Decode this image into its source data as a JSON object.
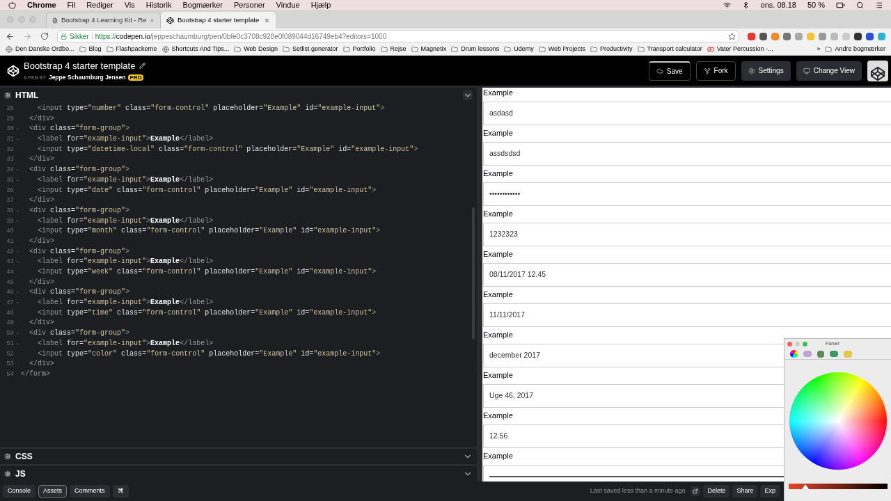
{
  "menu_bar": {
    "app": "Chrome",
    "items": [
      "Fil",
      "Rediger",
      "Vis",
      "Historik",
      "Bogmærker",
      "Personer",
      "Vindue",
      "Hjælp"
    ],
    "clock": "ons. 08.18",
    "battery": "50 %"
  },
  "tabs": [
    {
      "title": "Bootstrap 4 Learning Kit - Re",
      "selected": false,
      "kind": "document"
    },
    {
      "title": "Bootstrap 4 starter template",
      "selected": true,
      "kind": "codepen"
    }
  ],
  "address_bar": {
    "security": "Sikker",
    "scheme": "https://",
    "host": "codepen.io",
    "path": "/jeppeschaumburg/pen/0bfe0c3708c928e0f089044d16749eb4?editors=1000"
  },
  "bookmarks": [
    {
      "label": "Den Danske Ordbo...",
      "kind": "site"
    },
    {
      "label": "Blog",
      "kind": "folder"
    },
    {
      "label": "Flashpackerne",
      "kind": "folder"
    },
    {
      "label": "Shortcuts And Tips...",
      "kind": "site"
    },
    {
      "label": "Web Design",
      "kind": "folder"
    },
    {
      "label": "Setlist generator",
      "kind": "folder"
    },
    {
      "label": "Portfolio",
      "kind": "folder"
    },
    {
      "label": "Rejse",
      "kind": "folder"
    },
    {
      "label": "Magnetix",
      "kind": "folder"
    },
    {
      "label": "Drum lessons",
      "kind": "folder"
    },
    {
      "label": "Udemy",
      "kind": "folder"
    },
    {
      "label": "Web Projects",
      "kind": "folder"
    },
    {
      "label": "Productivity",
      "kind": "folder"
    },
    {
      "label": "Transport calculator",
      "kind": "folder"
    },
    {
      "label": "Vater Percussion -...",
      "kind": "video"
    }
  ],
  "bookmarks_more": "»",
  "other_bookmarks": "Andre bogmærker",
  "pen": {
    "title": "Bootstrap 4 starter template",
    "by": "A PEN BY",
    "author": "Jeppe Schaumburg Jensen",
    "badge": "PRO"
  },
  "header_buttons": [
    {
      "label": "Save",
      "kind": "save"
    },
    {
      "label": "Fork",
      "kind": "fork"
    },
    {
      "label": "Settings",
      "kind": "settings"
    },
    {
      "label": "Change View",
      "kind": "view"
    }
  ],
  "panels": [
    {
      "title": "HTML",
      "expanded": true
    },
    {
      "title": "CSS",
      "expanded": false
    },
    {
      "title": "JS",
      "expanded": false
    }
  ],
  "code_lines": [
    {
      "number": "28",
      "fold": false,
      "text": "    <input type=\"number\" class=\"form-control\" placeholder=\"Example\" id=\"example-input\">"
    },
    {
      "number": "29",
      "fold": false,
      "text": "  </div>"
    },
    {
      "number": "30",
      "fold": true,
      "text": "  <div class=\"form-group\">"
    },
    {
      "number": "31",
      "fold": true,
      "text": "    <label for=\"example-input\">Example</label>"
    },
    {
      "number": "32",
      "fold": false,
      "text": "    <input type=\"datetime-local\" class=\"form-control\" placeholder=\"Example\" id=\"example-input\">"
    },
    {
      "number": "33",
      "fold": false,
      "text": "  </div>"
    },
    {
      "number": "34",
      "fold": true,
      "text": "  <div class=\"form-group\">"
    },
    {
      "number": "35",
      "fold": true,
      "text": "    <label for=\"example-input\">Example</label>"
    },
    {
      "number": "36",
      "fold": false,
      "text": "    <input type=\"date\" class=\"form-control\" placeholder=\"Example\" id=\"example-input\">"
    },
    {
      "number": "37",
      "fold": false,
      "text": "  </div>"
    },
    {
      "number": "38",
      "fold": true,
      "text": "  <div class=\"form-group\">"
    },
    {
      "number": "39",
      "fold": true,
      "text": "    <label for=\"example-input\">Example</label>"
    },
    {
      "number": "40",
      "fold": false,
      "text": "    <input type=\"month\" class=\"form-control\" placeholder=\"Example\" id=\"example-input\">"
    },
    {
      "number": "41",
      "fold": false,
      "text": "  </div>"
    },
    {
      "number": "42",
      "fold": true,
      "text": "  <div class=\"form-group\">"
    },
    {
      "number": "43",
      "fold": true,
      "text": "    <label for=\"example-input\">Example</label>"
    },
    {
      "number": "44",
      "fold": false,
      "text": "    <input type=\"week\" class=\"form-control\" placeholder=\"Example\" id=\"example-input\">"
    },
    {
      "number": "45",
      "fold": false,
      "text": "  </div>"
    },
    {
      "number": "46",
      "fold": true,
      "text": "  <div class=\"form-group\">"
    },
    {
      "number": "47",
      "fold": true,
      "text": "    <label for=\"example-input\">Example</label>"
    },
    {
      "number": "48",
      "fold": false,
      "text": "    <input type=\"time\" class=\"form-control\" placeholder=\"Example\" id=\"example-input\">"
    },
    {
      "number": "49",
      "fold": false,
      "text": "  </div>"
    },
    {
      "number": "50",
      "fold": true,
      "text": "  <div class=\"form-group\">"
    },
    {
      "number": "51",
      "fold": true,
      "text": "    <label for=\"example-input\">Example</label>"
    },
    {
      "number": "52",
      "fold": false,
      "text": "    <input type=\"color\" class=\"form-control\" placeholder=\"Example\" id=\"example-input\">"
    },
    {
      "number": "53",
      "fold": false,
      "text": "  </div>"
    },
    {
      "number": "54",
      "fold": false,
      "text": "</form>"
    }
  ],
  "preview_fields": [
    {
      "label": "Example",
      "value": "asdasd",
      "kind": "text"
    },
    {
      "label": "Example",
      "value": "assdsdsd",
      "kind": "text"
    },
    {
      "label": "Example",
      "value": "••••••••••••",
      "kind": "text"
    },
    {
      "label": "Example",
      "value": "1232323",
      "kind": "text"
    },
    {
      "label": "Example",
      "value": "08/11/2017 12.45",
      "kind": "text"
    },
    {
      "label": "Example",
      "value": "11/11/2017",
      "kind": "text"
    },
    {
      "label": "Example",
      "value": "december 2017",
      "kind": "text"
    },
    {
      "label": "Example",
      "value": "Uge 46, 2017",
      "kind": "text"
    },
    {
      "label": "Example",
      "value": "12.56",
      "kind": "text"
    },
    {
      "label": "Example",
      "kind": "color"
    }
  ],
  "footer_left": [
    {
      "label": "Console",
      "selected": false
    },
    {
      "label": "Assets",
      "selected": true
    },
    {
      "label": "Comments",
      "selected": false
    },
    {
      "label": "⌘",
      "selected": false
    }
  ],
  "footer_status": "Last saved less than a minute ago",
  "footer_right": [
    "Delete",
    "Share",
    "Exp"
  ],
  "color_panel": {
    "title": "Farver",
    "brightness": {
      "level": 0.17
    }
  }
}
